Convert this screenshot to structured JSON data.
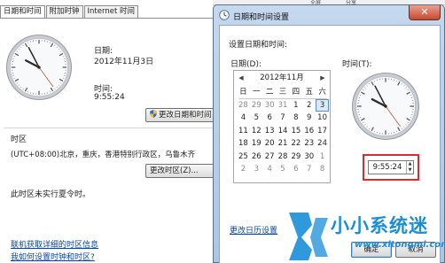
{
  "background_window": {
    "tabs": [
      "日期和时间",
      "附加时钟",
      "Internet 时间"
    ],
    "date_label": "日期:",
    "date_value": "2012年11月3日",
    "time_label": "时间:",
    "time_value": "9:55:24",
    "change_datetime_button": "更改日期和时间",
    "timezone_group_label": "时区",
    "timezone_value": "(UTC+08:00)北京，重庆，香港特别行政区，乌鲁木齐",
    "change_timezone_button": "更改时区(Z)...",
    "dst_note": "此时区未实行夏令时。",
    "link_timezone_info": "联机获取详细的时区信息",
    "link_how_set": "我如何设置时钟和时区?"
  },
  "behind_strip": {
    "items": [
      "全屏",
      "分享"
    ]
  },
  "dialog": {
    "title": "日期和时间设置",
    "close_glyph": "✕",
    "heading": "设置日期和时间:",
    "date_label": "日期(D):",
    "time_label": "时间(T):",
    "calendar": {
      "month_title": "2012年11月",
      "prev_arrow": "◀",
      "next_arrow": "▶",
      "weekdays": [
        "日",
        "一",
        "二",
        "三",
        "四",
        "五",
        "六"
      ],
      "weeks": [
        [
          {
            "d": "28",
            "dim": true
          },
          {
            "d": "29",
            "dim": true
          },
          {
            "d": "30",
            "dim": true
          },
          {
            "d": "31",
            "dim": true
          },
          {
            "d": "1"
          },
          {
            "d": "2"
          },
          {
            "d": "3",
            "sel": true
          }
        ],
        [
          {
            "d": "4"
          },
          {
            "d": "5"
          },
          {
            "d": "6"
          },
          {
            "d": "7"
          },
          {
            "d": "8"
          },
          {
            "d": "9"
          },
          {
            "d": "10"
          }
        ],
        [
          {
            "d": "11"
          },
          {
            "d": "12"
          },
          {
            "d": "13"
          },
          {
            "d": "14"
          },
          {
            "d": "15"
          },
          {
            "d": "16"
          },
          {
            "d": "17"
          }
        ],
        [
          {
            "d": "18"
          },
          {
            "d": "19"
          },
          {
            "d": "20"
          },
          {
            "d": "21"
          },
          {
            "d": "22"
          },
          {
            "d": "23"
          },
          {
            "d": "24"
          }
        ],
        [
          {
            "d": "25"
          },
          {
            "d": "26"
          },
          {
            "d": "27"
          },
          {
            "d": "28"
          },
          {
            "d": "29"
          },
          {
            "d": "30"
          },
          {
            "d": "1",
            "dim": true
          }
        ],
        [
          {
            "d": "2",
            "dim": true
          },
          {
            "d": "3",
            "dim": true
          },
          {
            "d": "4",
            "dim": true
          },
          {
            "d": "5",
            "dim": true
          },
          {
            "d": "6",
            "dim": true
          },
          {
            "d": "7",
            "dim": true
          },
          {
            "d": "8",
            "dim": true
          }
        ]
      ]
    },
    "time_value": "9:55:24",
    "spin_up": "▲",
    "spin_down": "▼",
    "link_calendar_settings": "更改日历设置",
    "ok_button": "确定",
    "cancel_button": "取消"
  },
  "watermark": {
    "text": "小小系统迷",
    "url": "www.xitongmi.com"
  },
  "colors": {
    "highlight_border": "#e02a2a",
    "link": "#0645ad",
    "watermark": "#1a8ed8",
    "title_gradient_top": "#c4d8ee",
    "close_button": "#c74a32"
  },
  "clock": {
    "hour": 9,
    "minute": 55,
    "second": 24
  }
}
